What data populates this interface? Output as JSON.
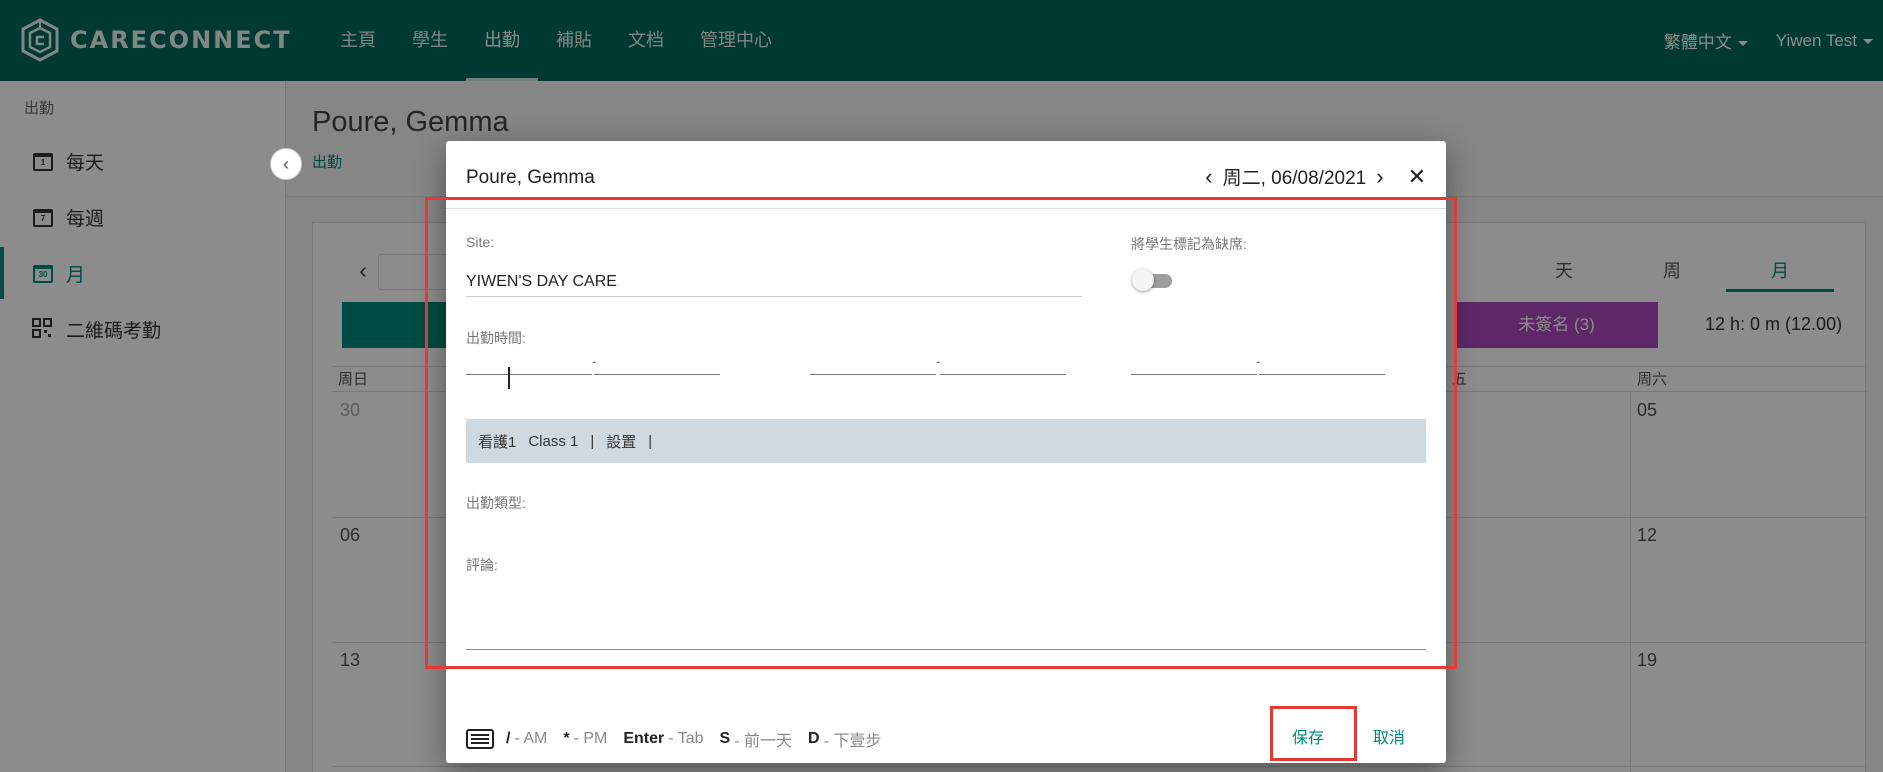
{
  "app": {
    "logo_text": "CARECONNECT"
  },
  "nav": {
    "items": [
      "主頁",
      "學生",
      "出勤",
      "補貼",
      "文档",
      "管理中心"
    ],
    "active": "出勤",
    "language": "繁體中文",
    "user": "Yiwen Test"
  },
  "sidebar": {
    "title": "出勤",
    "items": [
      {
        "label": "每天",
        "icon": "calendar-day-icon",
        "icon_num": "1"
      },
      {
        "label": "每週",
        "icon": "calendar-week-icon",
        "icon_num": "7"
      },
      {
        "label": "月",
        "icon": "calendar-month-icon",
        "icon_num": "30",
        "active": true
      },
      {
        "label": "二維碼考勤",
        "icon": "qr-code-icon"
      }
    ]
  },
  "page": {
    "title": "Poure, Gemma",
    "breadcrumb": "出勤"
  },
  "calendar": {
    "view_tabs": [
      "天",
      "周",
      "月"
    ],
    "active_view": "月",
    "unsigned_label": "未簽名 (3)",
    "hours": "12 h: 0 m (12.00)",
    "dow_first": "周日",
    "dow_partial": "五",
    "dow_last": "周六",
    "days": {
      "r1_first": "30",
      "r1_last": "05",
      "r2_first": "06",
      "r2_last": "12",
      "r3_first": "13",
      "r3_last": "19"
    }
  },
  "dialog": {
    "title": "Poure, Gemma",
    "date": "周二, 06/08/2021",
    "site_label": "Site:",
    "site_value": "YIWEN'S DAY CARE",
    "absent_label": "將學生標記為缺席:",
    "absent": false,
    "attendance_time_label": "出勤時間:",
    "class_bar": {
      "nurse": "看護1",
      "class": "Class 1",
      "sep": "|",
      "settings": "設置"
    },
    "attendance_type_label": "出勤類型:",
    "comment_label": "評論:",
    "shortcuts": [
      {
        "key": "/",
        "desc": "- AM"
      },
      {
        "key": "*",
        "desc": "- PM"
      },
      {
        "key": "Enter",
        "desc": "- Tab"
      },
      {
        "key": "S",
        "desc": "- 前一天"
      },
      {
        "key": "D",
        "desc": "- 下壹步"
      }
    ],
    "save_label": "保存",
    "cancel_label": "取消"
  },
  "colors": {
    "brand": "#00695c",
    "accent": "#00897b",
    "highlight": "#e53935",
    "unsigned": "#ab47bc"
  }
}
